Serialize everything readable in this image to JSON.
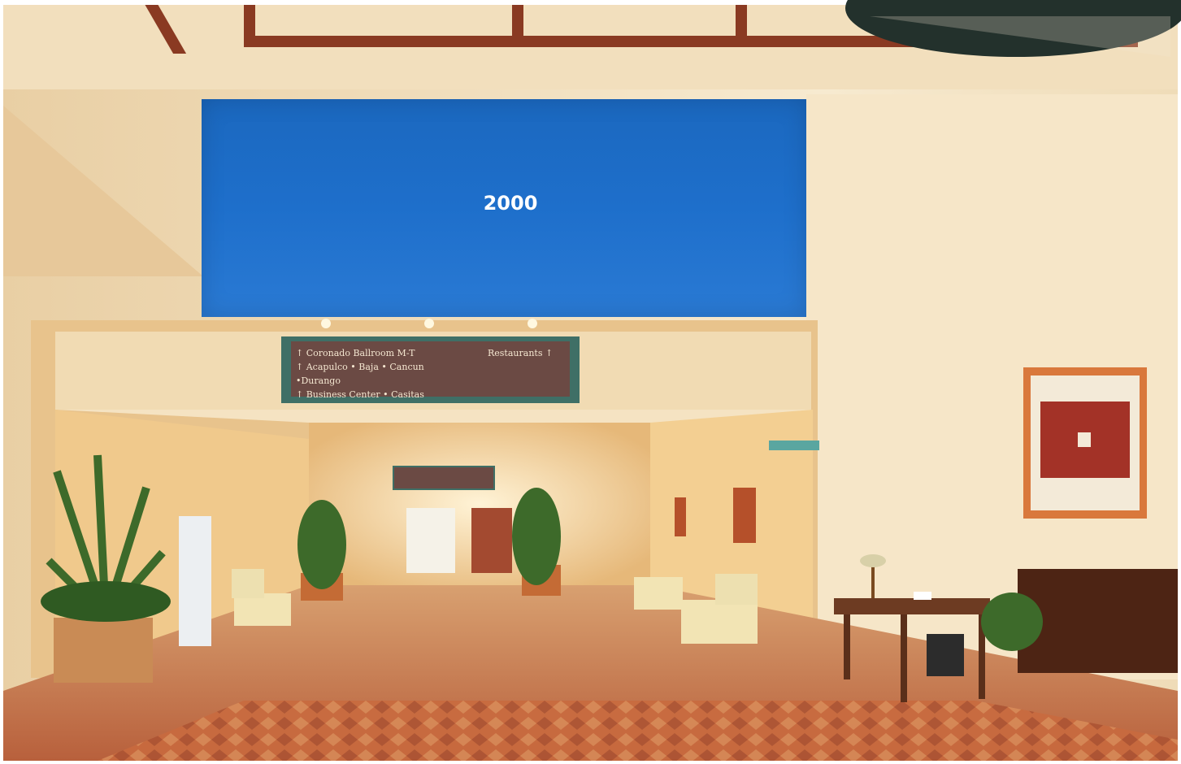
{
  "panel": {
    "label": "2000",
    "color": "#1e6fcb"
  },
  "overhead_sign": {
    "lines": [
      "Coronado Ballroom M-T",
      "Acapulco • Baja • Cancun •Durango",
      "Business Center • Casitas"
    ],
    "right_label": "Restaurants"
  },
  "colors": {
    "wall": "#f3e2c2",
    "carpet": "#c8734d",
    "ceiling_beam": "#8a3a22",
    "sign_bg": "#6b4a44",
    "sign_border": "#3f6f66"
  }
}
